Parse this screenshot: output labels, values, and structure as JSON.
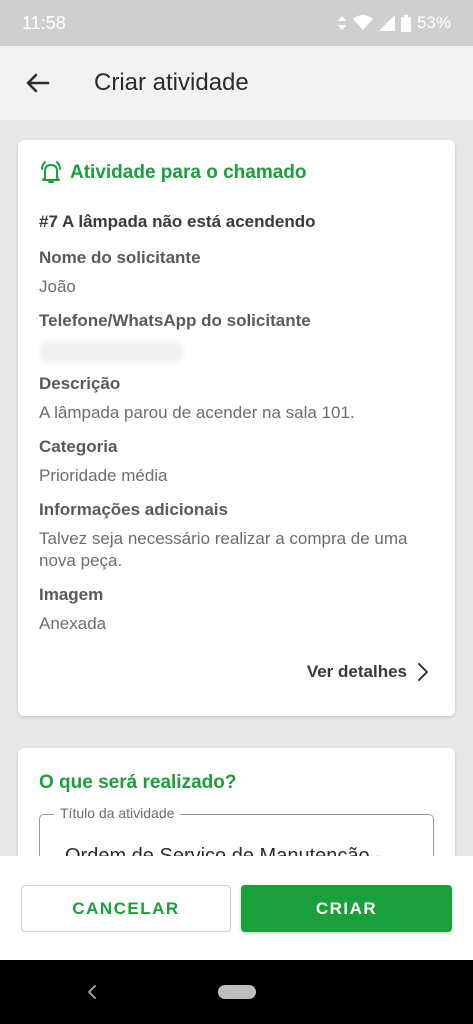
{
  "status_bar": {
    "time": "11:58",
    "battery": "53%"
  },
  "app_bar": {
    "title": "Criar atividade"
  },
  "activity_card": {
    "header": "Atividade para o chamado",
    "ticket": "#7 A lâmpada não está acendendo",
    "fields": [
      {
        "label": "Nome do solicitante",
        "value": "João"
      },
      {
        "label": "Telefone/WhatsApp do solicitante",
        "value": ""
      },
      {
        "label": "Descrição",
        "value": "A lâmpada parou de acender na sala 101."
      },
      {
        "label": "Categoria",
        "value": "Prioridade média"
      },
      {
        "label": "Informações adicionais",
        "value": "Talvez seja necessário realizar a compra de uma nova peça."
      },
      {
        "label": "Imagem",
        "value": "Anexada"
      }
    ],
    "details_link": "Ver detalhes"
  },
  "form_card": {
    "title": "O que será realizado?",
    "title_field": {
      "label": "Título da atividade",
      "value": "Ordem de Serviço de Manutenção -"
    }
  },
  "actions": {
    "cancel": "CANCELAR",
    "create": "CRIAR"
  },
  "colors": {
    "accent": "#1aa03a",
    "status_bar": "#cfcfcf",
    "app_bar": "#f2f2f2",
    "background": "#e8e8e8"
  },
  "icons": {
    "header_icon": "bell-ring-icon",
    "back": "arrow-left-icon",
    "details": "chevron-right-icon"
  }
}
